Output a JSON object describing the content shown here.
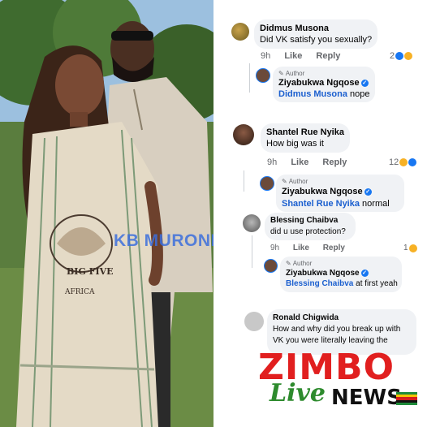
{
  "watermark": "KB MURONDAH",
  "comments": [
    {
      "author": "Didmus Musona",
      "text": "Did VK satisfy you sexually?",
      "time": "9h",
      "like_label": "Like",
      "reply_label": "Reply",
      "reaction_count": "2",
      "reply": {
        "author_tag": "Author",
        "author": "Ziyabukwa Ngqose",
        "mention": "Didmus Musona",
        "text": "nope"
      }
    },
    {
      "author": "Shantel Rue Nyika",
      "text": "How big was it",
      "time": "9h",
      "like_label": "Like",
      "reply_label": "Reply",
      "reaction_count": "12",
      "reply": {
        "author_tag": "Author",
        "author": "Ziyabukwa Ngqose",
        "mention": "Shantel Rue Nyika",
        "text": "normal"
      }
    },
    {
      "author": "Blessing Chaibva",
      "text": "did u use protection?",
      "time": "9h",
      "like_label": "Like",
      "reply_label": "Reply",
      "reaction_count": "1",
      "reply": {
        "author_tag": "Author",
        "author": "Ziyabukwa Ngqose",
        "mention": "Blessing Chaibva",
        "text": "at first yeah"
      }
    },
    {
      "author": "Ronald Chigwida",
      "text_line1": "How and why did you break up with",
      "text_line2": "VK you were literally leaving  the"
    }
  ],
  "logo": {
    "zimbo": "ZIMBO",
    "live": "Live",
    "news": "NEWS"
  },
  "photo_text": {
    "big_five": "BIG FIVE",
    "africa": "AFRICA"
  },
  "colors": {
    "mention": "#1b5fcf",
    "verified": "#1877f2",
    "zimbo_red": "#e11f1f",
    "live_green": "#2e8b2e"
  },
  "icons": [
    "verified-badge-icon",
    "like-reaction-icon",
    "haha-reaction-icon",
    "avatar-icon"
  ]
}
